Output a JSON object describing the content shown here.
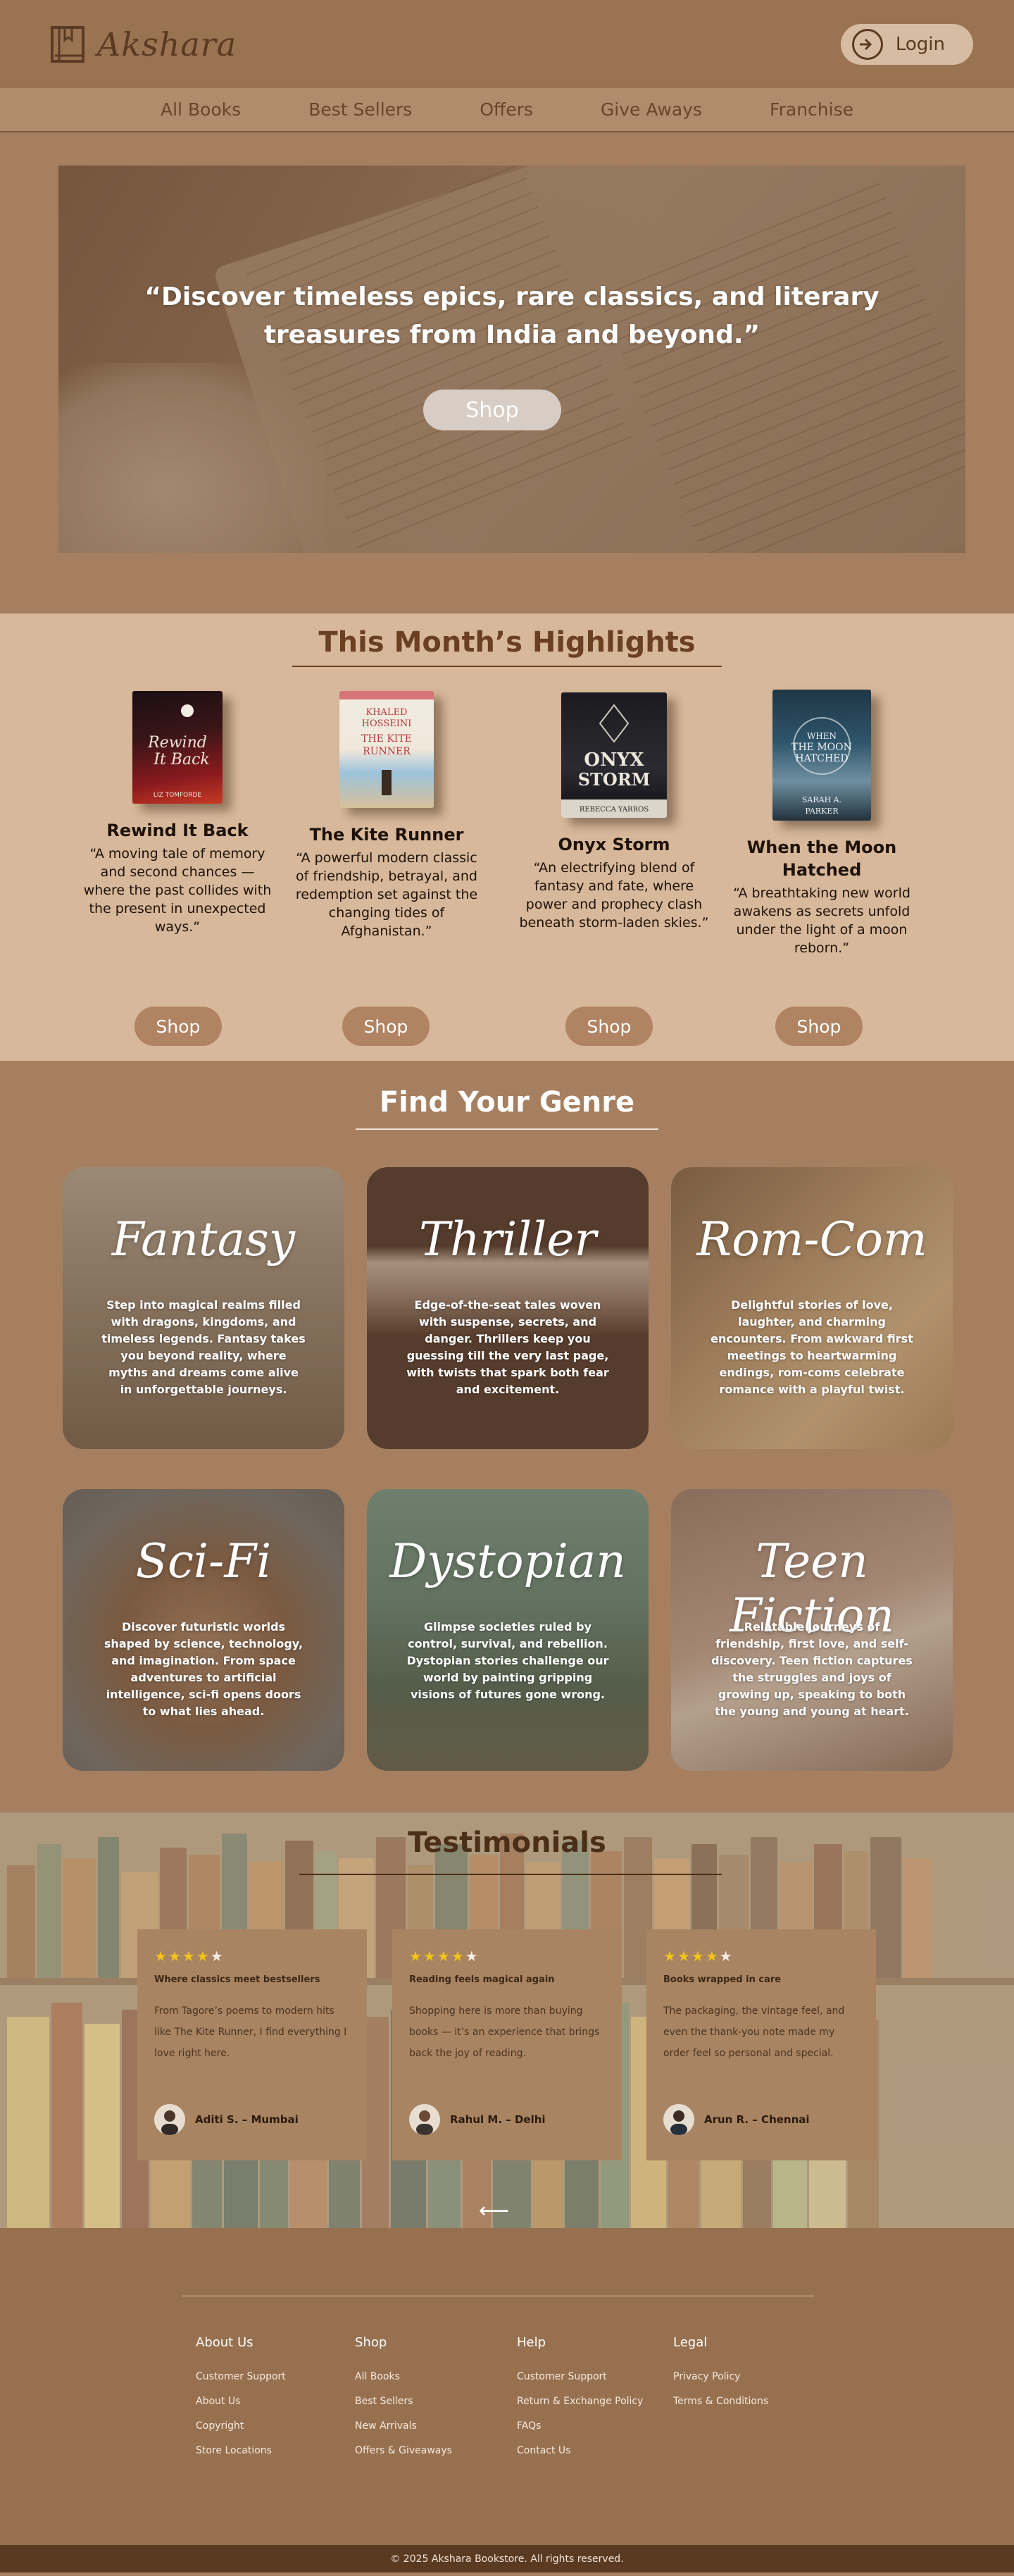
{
  "header": {
    "brand": "Akshara",
    "login_label": "Login"
  },
  "nav": {
    "items": [
      "All Books",
      "Best Sellers",
      "Offers",
      "Give Aways",
      "Franchise"
    ]
  },
  "hero": {
    "quote_line1": "“Discover timeless epics, rare classics, and literary",
    "quote_line2": "treasures from India and beyond.”",
    "shop_label": "Shop"
  },
  "highlights": {
    "title": "This Month’s Highlights",
    "books": [
      {
        "title": "Rewind It Back",
        "cover_title": "Rewind It Back",
        "author": "LIZ TOMFORDE",
        "desc_lines": [
          "“A moving tale of memory",
          "and second chances —",
          "where the past collides with",
          "the present in unexpected",
          "ways.”"
        ],
        "shop_label": "Shop"
      },
      {
        "title": "The Kite Runner",
        "cover_author": "KHALED HOSSEINI",
        "cover_title": "THE KITE RUNNER",
        "desc_lines": [
          "“A powerful modern classic",
          "of friendship, betrayal, and",
          "redemption set against the",
          "changing tides of",
          "Afghanistan.”"
        ],
        "shop_label": "Shop"
      },
      {
        "title": "Onyx Storm",
        "cover_title": "ONYX STORM",
        "author": "REBECCA YARROS",
        "desc_lines": [
          "“An electrifying blend of",
          "fantasy and fate, where",
          "power and prophecy clash",
          "beneath storm-laden skies.”"
        ],
        "shop_label": "Shop"
      },
      {
        "title_line1": "When the Moon",
        "title_line2": "Hatched",
        "cover_title": "WHEN THE MOON HATCHED",
        "author": "SARAH A. PARKER",
        "desc_lines": [
          "“A breathtaking new world",
          "awakens as secrets unfold",
          "under the light of a moon",
          "reborn.”"
        ],
        "shop_label": "Shop"
      }
    ]
  },
  "genres": {
    "title": "Find Your Genre",
    "cards": [
      {
        "name": "Fantasy",
        "desc": "Step into magical realms filled with dragons, kingdoms, and timeless legends. Fantasy takes you beyond reality, where myths and dreams come alive in unforgettable journeys."
      },
      {
        "name": "Thriller",
        "desc": "Edge-of-the-seat tales woven with suspense, secrets, and danger. Thrillers keep you guessing till the very last page, with twists that spark both fear and excitement."
      },
      {
        "name": "Rom-Com",
        "desc": "Delightful stories of love, laughter, and charming encounters. From awkward first meetings to heartwarming endings, rom-coms celebrate romance with a playful twist."
      },
      {
        "name": "Sci-Fi",
        "desc": "Discover futuristic worlds shaped by science, technology, and imagination. From space adventures to artificial intelligence, sci-fi opens doors to what lies ahead."
      },
      {
        "name": "Dystopian",
        "desc": "Glimpse societies ruled by control, survival, and rebellion. Dystopian stories challenge our world by painting gripping visions of futures gone wrong."
      },
      {
        "name": "Teen Fiction",
        "desc": "Relatable journeys of friendship, first love, and self-discovery. Teen fiction captures the struggles and joys of growing up, speaking to both the young and young at heart."
      }
    ]
  },
  "testimonials": {
    "title": "Testimonials",
    "cards": [
      {
        "stars": 4,
        "headline": "Where classics meet bestsellers",
        "body": "From Tagore’s poems to modern hits like The Kite Runner, I find everything I love right here.",
        "author": "Aditi S. – Mumbai"
      },
      {
        "stars": 4,
        "headline": "Reading feels magical again",
        "body": "Shopping here is more than buying books — it’s an experience that brings back the joy of reading.",
        "author": "Rahul M. – Delhi"
      },
      {
        "stars": 4,
        "headline": "Books wrapped in care",
        "body": "The packaging, the vintage feel, and even the thank-you note made my order feel so personal and special.",
        "author": "Arun R. – Chennai"
      }
    ]
  },
  "footer": {
    "columns": [
      {
        "heading": "About Us",
        "links": [
          "Customer Support",
          "About Us",
          "Copyright",
          "Store Locations"
        ]
      },
      {
        "heading": "Shop",
        "links": [
          "All Books",
          "Best Sellers",
          "New Arrivals",
          "Offers & Giveaways"
        ]
      },
      {
        "heading": "Help",
        "links": [
          "Customer Support",
          "Return & Exchange Policy",
          "FAQs",
          "Contact Us"
        ]
      },
      {
        "heading": "Legal",
        "links": [
          "Privacy Policy",
          "Terms & Conditions"
        ]
      }
    ],
    "copyright": "© 2025 Akshara Bookstore. All rights reserved."
  }
}
